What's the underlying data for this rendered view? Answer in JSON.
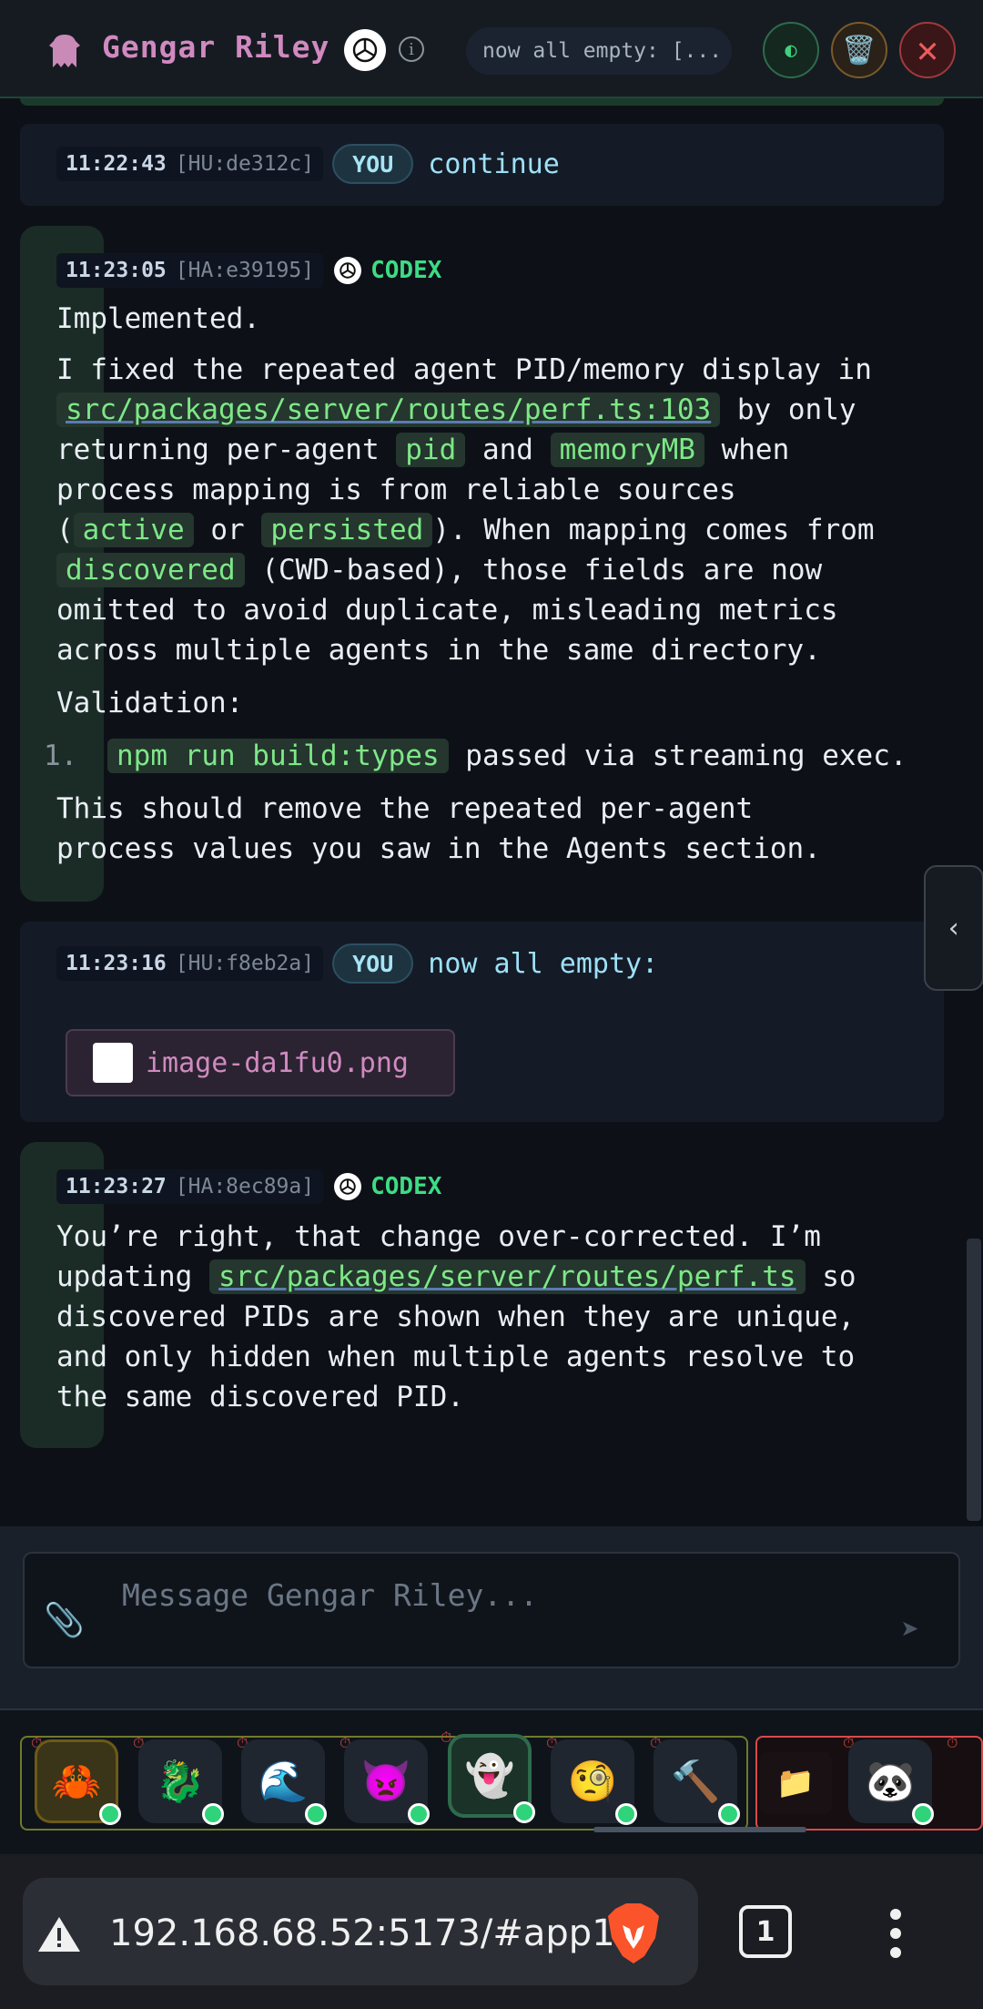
{
  "header": {
    "agent_name": "Gengar Riley",
    "status_pill": "now all empty: [...",
    "theme_icon": "half-circle-icon",
    "trash_icon": "trash-icon",
    "close_icon": "close-icon"
  },
  "messages": [
    {
      "role": "user",
      "time": "11:22:43",
      "hash": "[HU:de312c]",
      "badge": "YOU",
      "text": "continue"
    },
    {
      "role": "agent",
      "time": "11:23:05",
      "hash": "[HA:e39195]",
      "badge": "CODEX",
      "p1": "Implemented.",
      "p2_a": "I fixed the repeated agent PID/memory display in",
      "p2_link": "src/packages/server/routes/perf.ts:103",
      "p2_b": "by only",
      "p2_c": "returning per-agent",
      "code_pid": "pid",
      "p2_and": "and",
      "code_mem": "memoryMB",
      "p2_d": "when",
      "p2_e": "process mapping is from reliable sources",
      "p2_paren_open": "(",
      "code_active": "active",
      "p2_or": "or",
      "code_persisted": "persisted",
      "p2_f": "). When mapping comes from",
      "code_discovered": "discovered",
      "p2_g": "(CWD-based), those fields are now",
      "p2_h": "omitted to avoid duplicate, misleading metrics",
      "p2_i": "across multiple agents in the same directory.",
      "validation": "Validation:",
      "list_num": "1.",
      "list_code": "npm run build:types",
      "list_text": "passed via streaming exec.",
      "p3_a": "This should remove the repeated per-agent",
      "p3_b": "process values you saw in the Agents section."
    },
    {
      "role": "user",
      "time": "11:23:16",
      "hash": "[HU:f8eb2a]",
      "badge": "YOU",
      "text": "now all empty:",
      "attachment": "image-da1fu0.png"
    },
    {
      "role": "agent",
      "time": "11:23:27",
      "hash": "[HA:8ec89a]",
      "badge": "CODEX",
      "p1_a": "You’re right, that change over-corrected. I’m",
      "p1_b": "updating",
      "p1_link": "src/packages/server/routes/perf.ts",
      "p1_c": "so",
      "p1_d": "discovered PIDs are shown when they are unique,",
      "p1_e": "and only hidden when multiple agents resolve to",
      "p1_f": "the same discovered PID."
    }
  ],
  "composer": {
    "placeholder": "Message Gengar Riley...",
    "attach_icon": "paperclip-icon",
    "send_icon": "send-icon"
  },
  "agents": [
    {
      "emoji": "🦀",
      "name": "crab"
    },
    {
      "emoji": "🐉",
      "name": "dragon"
    },
    {
      "emoji": "🌊",
      "name": "wave"
    },
    {
      "emoji": "👿",
      "name": "imp"
    },
    {
      "emoji": "👻",
      "name": "ghost"
    },
    {
      "emoji": "🧐",
      "name": "monocle"
    },
    {
      "emoji": "🔨",
      "name": "hammer"
    },
    {
      "emoji": "📁",
      "name": "folder"
    },
    {
      "emoji": "🐼",
      "name": "panda"
    }
  ],
  "browser": {
    "url": "192.168.68.52:5173/#app1",
    "tab_count": "1"
  },
  "colors": {
    "accent_green": "#3ddc84",
    "title_pink": "#d08ac0",
    "user_text": "#9ee0f7"
  }
}
